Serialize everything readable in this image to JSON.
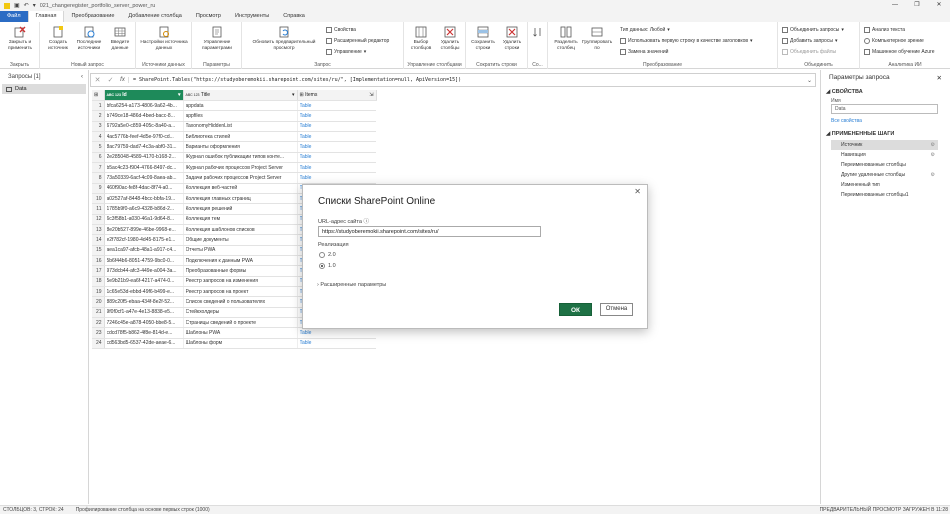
{
  "window": {
    "title": "021_changeregister_portfolio_server_power_ru",
    "controls": [
      "—",
      "❐",
      "✕"
    ]
  },
  "ribbon_tabs": [
    {
      "label": "Файл"
    },
    {
      "label": "Главная"
    },
    {
      "label": "Преобразование"
    },
    {
      "label": "Добавление столбца"
    },
    {
      "label": "Просмотр"
    },
    {
      "label": "Инструменты"
    },
    {
      "label": "Справка"
    }
  ],
  "ribbon": {
    "close": {
      "btn": "Закрыть и применить",
      "group": "Закрыть"
    },
    "new_query": {
      "btns": [
        "Создать источник",
        "Последние источники",
        "Введите данные"
      ],
      "group": "Новый запрос"
    },
    "data_sources": {
      "btn": "Настройки источника данных",
      "group": "Источники данных"
    },
    "params": {
      "btn": "Управление параметрами",
      "group": "Параметры"
    },
    "query": {
      "btn": "Обновить предварительный просмотр",
      "small": [
        "Свойства",
        "Расширенный редактор",
        "Управление"
      ],
      "group": "Запрос"
    },
    "manage_cols": {
      "btns": [
        "Выбор столбцов",
        "Удалить столбцы"
      ],
      "group": "Управление столбцами"
    },
    "reduce_rows": {
      "btns": [
        "Сохранить строки",
        "Удалить строки"
      ],
      "group": "Сократить строки"
    },
    "sort": {
      "group": "Со..."
    },
    "transform": {
      "btns": [
        "Разделить столбец",
        "Группировать по"
      ],
      "small": [
        "Тип данных: Любой",
        "Использовать первую строку в качестве заголовков",
        "Замена значений"
      ],
      "group": "Преобразование"
    },
    "combine": {
      "small": [
        "Объединить запросы",
        "Добавить запросы",
        "Объединить файлы"
      ],
      "group": "Объединить"
    },
    "ai": {
      "small": [
        "Анализ текста",
        "Компьютерное зрение",
        "Машинное обучение Azure"
      ],
      "group": "Аналитика ИИ"
    }
  },
  "queries_pane": {
    "title": "Запросы [1]",
    "items": [
      {
        "label": "Data"
      }
    ]
  },
  "formula": {
    "text": "= SharePoint.Tables(\"https://studyoberemokii.sharepoint.com/sites/ru/\", [Implementation=null, ApiVersion=15])"
  },
  "grid": {
    "columns": [
      {
        "type": "ABC 123",
        "name": "Id"
      },
      {
        "type": "ABC 123",
        "name": "Title"
      },
      {
        "type": "⊞",
        "name": "Items"
      }
    ],
    "rows": [
      {
        "n": "1",
        "id": "bfca6254-a173-4806-9a62-4b...",
        "title": "appdata",
        "items": "Table"
      },
      {
        "n": "2",
        "id": "b749ce18-486d-4bed-bacc-8...",
        "title": "appfiles",
        "items": "Table"
      },
      {
        "n": "3",
        "id": "6792a5e0-c859-405c-8a40-a...",
        "title": "TaxonomyHiddenList",
        "items": "Table"
      },
      {
        "n": "4",
        "id": "4ac5776b-feef-4d5e-97f0-cd...",
        "title": "Библиотека стилей",
        "items": "Table"
      },
      {
        "n": "5",
        "id": "8ac79759-dad7-4c3a-abf0-31...",
        "title": "Варианты оформления",
        "items": "Table"
      },
      {
        "n": "6",
        "id": "2e285048-4589-4170-b168-2...",
        "title": "Журнал ошибок публикации типов конте...",
        "items": "Table"
      },
      {
        "n": "7",
        "id": "b5ac4c23-f904-4766-8497-dc...",
        "title": "Журнал рабочих процессов Project Server",
        "items": "Table"
      },
      {
        "n": "8",
        "id": "73a50339-6acf-4c09-8aea-ab...",
        "title": "Задачи рабочих процессов Project Server",
        "items": "Table"
      },
      {
        "n": "9",
        "id": "460f90ac-fe8f-4dac-8f74-a0...",
        "title": "Коллекция веб-частей",
        "items": "Table"
      },
      {
        "n": "10",
        "id": "a02527af-8448-4bcc-bbfa-19...",
        "title": "Коллекция главных страниц",
        "items": "Table"
      },
      {
        "n": "11",
        "id": "1785b9f0-a6c9-4328-b86d-2...",
        "title": "Коллекция решений",
        "items": "Table"
      },
      {
        "n": "12",
        "id": "6c3f58b1-a030-46a1-9d64-8...",
        "title": "Коллекция тем",
        "items": "Table"
      },
      {
        "n": "13",
        "id": "8e20b527-899e-46be-9968-e...",
        "title": "Коллекция шаблонов списков",
        "items": "Table"
      },
      {
        "n": "14",
        "id": "e2f782cf-1980-4d45-8175-e1...",
        "title": "Общие документы",
        "items": "Table"
      },
      {
        "n": "15",
        "id": "aea1ca97-afcb-48a1-a917-c4...",
        "title": "Отчеты PWA",
        "items": "Table"
      },
      {
        "n": "16",
        "id": "5b6f44b6-8051-4759-9bc0-0...",
        "title": "Подключения к данным PWA",
        "items": "Table"
      },
      {
        "n": "17",
        "id": "973dcb44-afc3-449e-a004-3a...",
        "title": "Преобразованные формы",
        "items": "Table"
      },
      {
        "n": "18",
        "id": "5e9b21b9-ea6f-4217-a474-0...",
        "title": "Реестр запросов на изменения",
        "items": "Table"
      },
      {
        "n": "19",
        "id": "1c65e53d-ebbd-49f6-b499-e...",
        "title": "Реестр запросов на проект",
        "items": "Table"
      },
      {
        "n": "20",
        "id": "889c20f5-ebaa-434f-8e2f-52...",
        "title": "Список сведений о пользователях",
        "items": "Table"
      },
      {
        "n": "21",
        "id": "9f0f0cf1-a47e-4e13-8838-e5...",
        "title": "Стейкхолдеры",
        "items": "Table"
      },
      {
        "n": "22",
        "id": "7246c45e-a878-4050-bbe8-5...",
        "title": "Страницы сведений о проекте",
        "items": "Table"
      },
      {
        "n": "23",
        "id": "cdcd78f5-b862-4f8e-814d-e...",
        "title": "Шаблоны PWA",
        "items": "Table"
      },
      {
        "n": "24",
        "id": "cd563bd5-6537-42de-aeae-6...",
        "title": "Шаблоны форм",
        "items": "Table"
      }
    ]
  },
  "dialog": {
    "title": "Списки SharePoint Online",
    "url_label": "URL-адрес сайта",
    "url_value": "https://studyoberemokii.sharepoint.com/sites/ru/",
    "impl_label": "Реализация",
    "opt_20": "2.0",
    "opt_10": "1.0",
    "advanced": "Расширенные параметры",
    "ok": "ОК",
    "cancel": "Отмена"
  },
  "query_settings": {
    "title": "Параметры запроса",
    "props_header": "СВОЙСТВА",
    "name_label": "Имя",
    "name_value": "Data",
    "all_props": "Все свойства",
    "steps_header": "ПРИМЕНЕННЫЕ ШАГИ",
    "steps": [
      {
        "label": "Источник",
        "gear": true
      },
      {
        "label": "Навигация",
        "gear": true
      },
      {
        "label": "Переименованные столбцы",
        "gear": false
      },
      {
        "label": "Другие удаленные столбцы",
        "gear": true
      },
      {
        "label": "Измененный тип",
        "gear": false
      },
      {
        "label": "Переименованные столбцы1",
        "gear": false
      }
    ]
  },
  "status": {
    "left": "СТОЛБЦОВ: 3, СТРОК: 24",
    "middle": "Профилирование столбца на основе первых строк (1000)",
    "right": "ПРЕДВАРИТЕЛЬНЫЙ ПРОСМОТР ЗАГРУЖЕН В 11:28"
  },
  "colors": {
    "accent": "#1e7145",
    "file_tab": "#2b6cc4",
    "link": "#2a7fd4",
    "id_header": "#1e8a5a"
  }
}
